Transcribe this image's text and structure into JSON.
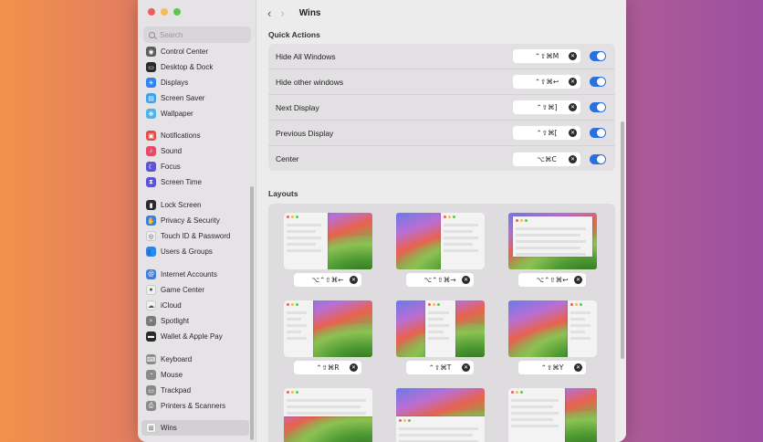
{
  "search": {
    "placeholder": "Search"
  },
  "sidebar": {
    "items": [
      {
        "label": "Control Center",
        "icon": "control-center-icon",
        "color": "#5c5c5c",
        "glyph": "◉"
      },
      {
        "label": "Desktop & Dock",
        "icon": "dock-icon",
        "color": "#2a2a2a",
        "glyph": "▭"
      },
      {
        "label": "Displays",
        "icon": "displays-icon",
        "color": "#2f82f2",
        "glyph": "☀"
      },
      {
        "label": "Screen Saver",
        "icon": "screen-saver-icon",
        "color": "#3ea2e8",
        "glyph": "▤"
      },
      {
        "label": "Wallpaper",
        "icon": "wallpaper-icon",
        "color": "#4cb4e6",
        "glyph": "❋"
      },
      {
        "label": "Notifications",
        "icon": "notifications-icon",
        "color": "#e74a46",
        "glyph": "▣"
      },
      {
        "label": "Sound",
        "icon": "sound-icon",
        "color": "#e34c6a",
        "glyph": "♪"
      },
      {
        "label": "Focus",
        "icon": "focus-icon",
        "color": "#5b52d6",
        "glyph": "☾"
      },
      {
        "label": "Screen Time",
        "icon": "screen-time-icon",
        "color": "#5b52d6",
        "glyph": "⧗"
      },
      {
        "label": "Lock Screen",
        "icon": "lock-screen-icon",
        "color": "#2a2a2a",
        "glyph": "▮"
      },
      {
        "label": "Privacy & Security",
        "icon": "privacy-hand-icon",
        "color": "#3b7fe5",
        "glyph": "✋"
      },
      {
        "label": "Touch ID & Password",
        "icon": "fingerprint-icon",
        "color": "#f0f0f0",
        "glyph": "◎"
      },
      {
        "label": "Users & Groups",
        "icon": "users-icon",
        "color": "#3b7fe5",
        "glyph": "👥"
      },
      {
        "label": "Internet Accounts",
        "icon": "at-sign-icon",
        "color": "#3b7fe5",
        "glyph": "@"
      },
      {
        "label": "Game Center",
        "icon": "game-center-icon",
        "color": "#f0f0f0",
        "glyph": "●"
      },
      {
        "label": "iCloud",
        "icon": "cloud-icon",
        "color": "#f0f0f0",
        "glyph": "☁"
      },
      {
        "label": "Spotlight",
        "icon": "spotlight-icon",
        "color": "#7a7a7a",
        "glyph": "⌕"
      },
      {
        "label": "Wallet & Apple Pay",
        "icon": "wallet-icon",
        "color": "#2a2a2a",
        "glyph": "▬"
      },
      {
        "label": "Keyboard",
        "icon": "keyboard-icon",
        "color": "#8a8a8a",
        "glyph": "⌨"
      },
      {
        "label": "Mouse",
        "icon": "mouse-icon",
        "color": "#8a8a8a",
        "glyph": "◔"
      },
      {
        "label": "Trackpad",
        "icon": "trackpad-icon",
        "color": "#8a8a8a",
        "glyph": "▭"
      },
      {
        "label": "Printers & Scanners",
        "icon": "printer-icon",
        "color": "#8a8a8a",
        "glyph": "⎙"
      },
      {
        "label": "Wins",
        "icon": "wins-app-icon",
        "color": "#f6f6f6",
        "glyph": "⊞"
      }
    ]
  },
  "header": {
    "title": "Wins",
    "back": "‹",
    "forward": "›"
  },
  "quick_actions": {
    "title": "Quick Actions",
    "rows": [
      {
        "label": "Hide All Windows",
        "shortcut": "⌃⇧⌘M",
        "enabled": true
      },
      {
        "label": "Hide other windows",
        "shortcut": "⌃⇧⌘↩",
        "enabled": true
      },
      {
        "label": "Next Display",
        "shortcut": "⌃⇧⌘]",
        "enabled": true
      },
      {
        "label": "Previous Display",
        "shortcut": "⌃⇧⌘[",
        "enabled": true
      },
      {
        "label": "Center",
        "shortcut": "⌥⌘C",
        "enabled": true
      }
    ]
  },
  "layouts": {
    "title": "Layouts",
    "tiles": [
      {
        "name": "left-half",
        "shortcut": "⌥⌃⇧⌘←"
      },
      {
        "name": "right-half",
        "shortcut": "⌥⌃⇧⌘→"
      },
      {
        "name": "maximize",
        "shortcut": "⌥⌃⇧⌘↩"
      },
      {
        "name": "left-third",
        "shortcut": "⌃⇧⌘R"
      },
      {
        "name": "center-third",
        "shortcut": "⌃⇧⌘T"
      },
      {
        "name": "right-third",
        "shortcut": "⌃⇧⌘Y"
      },
      {
        "name": "top-half",
        "shortcut": ""
      },
      {
        "name": "bottom-half",
        "shortcut": ""
      },
      {
        "name": "top-right-quarter",
        "shortcut": ""
      }
    ]
  },
  "colors": {
    "accent": "#2a6fe0",
    "close": "#ec5f57",
    "minimize": "#f4bd4f",
    "zoom": "#5fc454"
  }
}
